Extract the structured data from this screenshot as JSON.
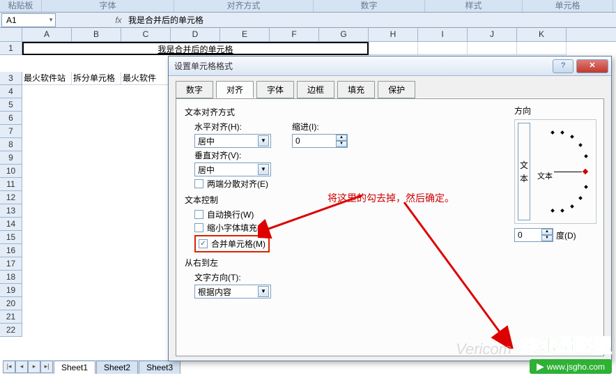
{
  "ribbon": {
    "groups": [
      "粘贴板",
      "字体",
      "对齐方式",
      "数字",
      "样式",
      "单元格"
    ]
  },
  "nameBox": "A1",
  "fx": "fx",
  "formula": "我是合并后的单元格",
  "columns": [
    "A",
    "B",
    "C",
    "D",
    "E",
    "F",
    "G",
    "H",
    "I",
    "J",
    "K"
  ],
  "mergedCellText": "我是合并后的单元格",
  "row2": [
    "最火软件站",
    "拆分单元格",
    "最火软件"
  ],
  "sheets": [
    "Sheet1",
    "Sheet2",
    "Sheet3"
  ],
  "dialog": {
    "title": "设置单元格格式",
    "tabs": [
      "数字",
      "对齐",
      "字体",
      "边框",
      "填充",
      "保护"
    ],
    "activeTab": 1,
    "alignSection": "文本对齐方式",
    "hAlignLabel": "水平对齐(H):",
    "hAlignValue": "居中",
    "indentLabel": "缩进(I):",
    "indentValue": "0",
    "vAlignLabel": "垂直对齐(V):",
    "vAlignValue": "居中",
    "justifyDistributed": "两端分散对齐(E)",
    "textControlSection": "文本控制",
    "wrapText": "自动换行(W)",
    "shrinkToFit": "缩小字体填充(K)",
    "mergeCells": "合并单元格(M)",
    "rtlSection": "从右到左",
    "textDirLabel": "文字方向(T):",
    "textDirValue": "根据内容",
    "orientationLabel": "方向",
    "vertTextChars": [
      "文",
      "本"
    ],
    "dialText": "文本",
    "degreeValue": "0",
    "degreeLabel": "度(D)"
  },
  "annotation": "将这里的勾去掉，然后确定。",
  "watermark": {
    "title": "技术员联盟",
    "url": "www.jsgho.com"
  },
  "vericomWatermark": "Vericom"
}
